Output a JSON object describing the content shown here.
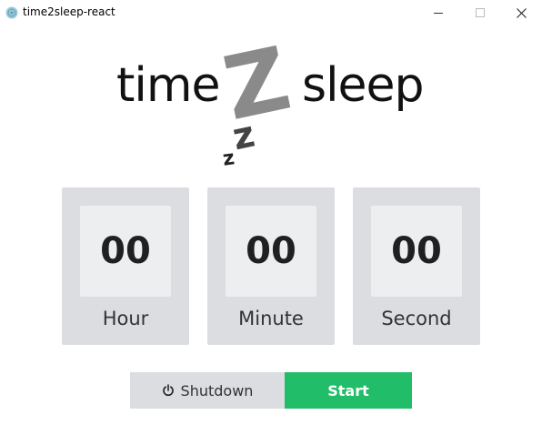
{
  "window": {
    "title": "time2sleep-react",
    "controls": {
      "minimize_icon": "minimize-icon",
      "maximize_icon": "maximize-icon",
      "close_icon": "close-icon"
    }
  },
  "logo": {
    "left_word": "time",
    "middle_glyph": "Z",
    "small_z1": "z",
    "small_z2": "z",
    "right_word": "sleep"
  },
  "timer": {
    "hour": {
      "value": "00",
      "label": "Hour"
    },
    "minute": {
      "value": "00",
      "label": "Minute"
    },
    "second": {
      "value": "00",
      "label": "Second"
    }
  },
  "actions": {
    "shutdown_label": "Shutdown",
    "shutdown_icon": "power-icon",
    "start_label": "Start"
  },
  "colors": {
    "card_bg": "#dcdde0",
    "value_box_bg": "#eceef0",
    "start_green": "#21bd68",
    "logo_z_gray": "#8a8a8a"
  }
}
